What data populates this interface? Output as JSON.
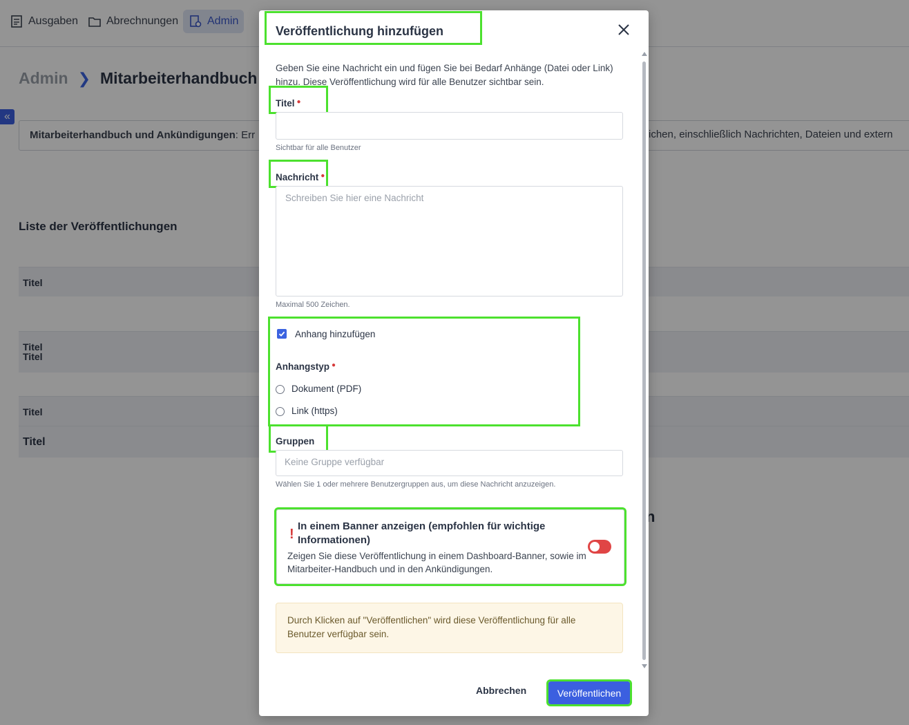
{
  "nav": {
    "items": [
      {
        "label": "Ausgaben",
        "icon": "receipt-icon"
      },
      {
        "label": "Abrechnungen",
        "icon": "folder-icon"
      },
      {
        "label": "Admin",
        "icon": "admin-settings-icon",
        "active": true
      }
    ]
  },
  "breadcrumb": {
    "root": "Admin",
    "page": "Mitarbeiterhandbuch u"
  },
  "infobox": {
    "bold": "Mitarbeiterhandbuch und Ankündigungen",
    "text": ": Err",
    "right_fragment": "ichen, einschließlich Nachrichten, Dateien und extern"
  },
  "list": {
    "title": "Liste der Veröffentlichungen",
    "rows": [
      "Titel",
      "Titel",
      "Titel",
      "Titel",
      "Titel"
    ]
  },
  "bg_fragment": "n",
  "modal": {
    "title": "Veröffentlichung hinzufügen",
    "intro": "Geben Sie eine Nachricht ein und fügen Sie bei Bedarf Anhänge (Datei oder Link) hinzu. Diese Veröffentlichung wird für alle Benutzer sichtbar sein.",
    "title_field": {
      "label": "Titel",
      "value": "",
      "hint": "Sichtbar für alle Benutzer"
    },
    "message_field": {
      "label": "Nachricht",
      "placeholder": "Schreiben Sie hier eine Nachricht",
      "hint": "Maximal 500 Zeichen."
    },
    "attachment": {
      "checkbox_label": "Anhang hinzufügen",
      "checked": true,
      "type_label": "Anhangstyp",
      "options": [
        "Dokument (PDF)",
        "Link (https)"
      ]
    },
    "groups": {
      "label": "Gruppen",
      "placeholder": "Keine Gruppe verfügbar",
      "hint": "Wählen Sie 1 oder mehrere Benutzergruppen aus, um diese Nachricht anzuzeigen."
    },
    "banner": {
      "title": "In einem Banner anzeigen (empfohlen für wichtige Informationen)",
      "description": "Zeigen Sie diese Veröffentlichung in einem Dashboard-Banner, sowie im Mitarbeiter-Handbuch und in den Ankündigungen.",
      "toggle_on": false
    },
    "notice": "Durch Klicken auf \"Veröffentlichen\" wird diese Veröffentlichung für alle Benutzer verfügbar sein.",
    "buttons": {
      "cancel": "Abbrechen",
      "publish": "Veröffentlichen"
    }
  },
  "colors": {
    "accent": "#3b5fe0",
    "highlight": "#4ce12e",
    "required": "#d63a3a",
    "toggle": "#e04545",
    "notice_bg": "#fdf6e6"
  }
}
